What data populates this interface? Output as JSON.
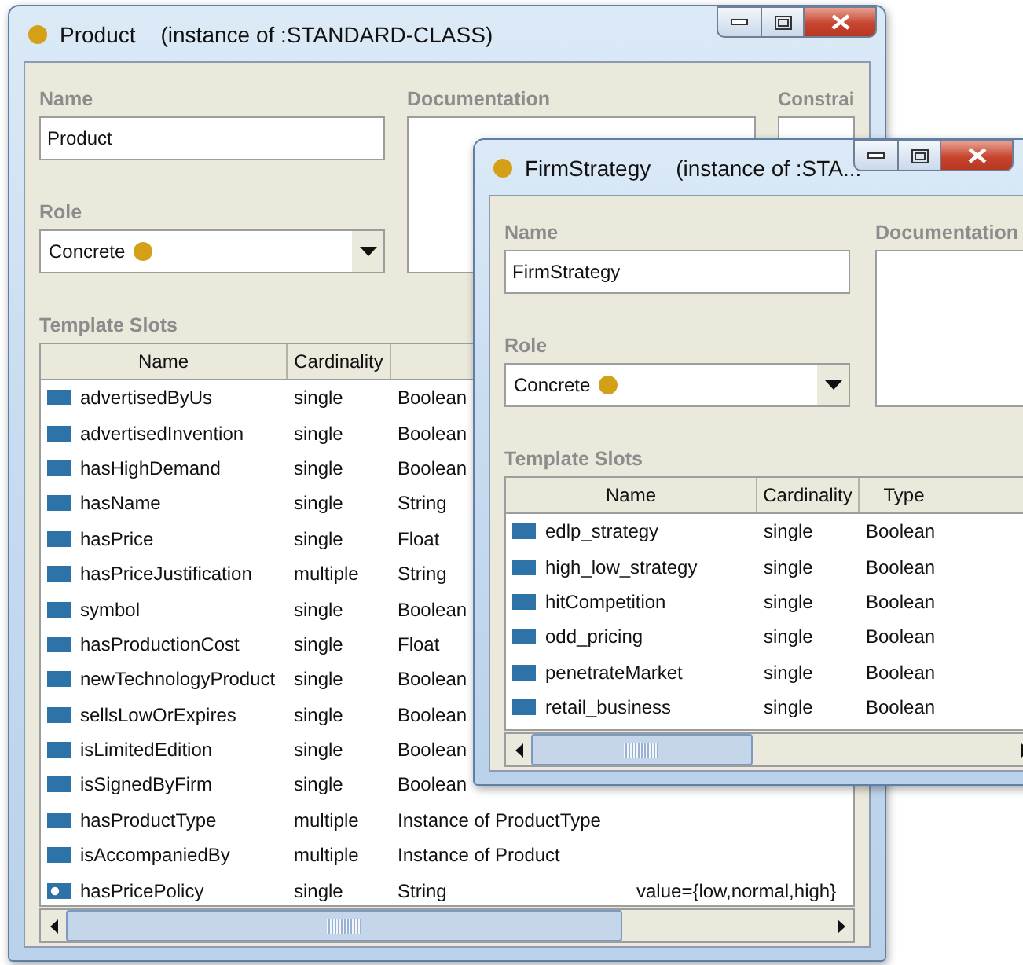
{
  "windows": [
    {
      "title": "Product",
      "subtitle": "(instance of :STANDARD-CLASS)",
      "name_label": "Name",
      "name_value": "Product",
      "documentation_label": "Documentation",
      "constraints_label": "Constrai",
      "role_label": "Role",
      "role_value": "Concrete",
      "slots_label": "Template Slots",
      "columns": [
        "Name",
        "Cardinality"
      ],
      "rows": [
        {
          "kind": "slot",
          "name": "advertisedByUs",
          "cardinality": "single",
          "type": "Boolean"
        },
        {
          "kind": "slot",
          "name": "advertisedInvention",
          "cardinality": "single",
          "type": "Boolean"
        },
        {
          "kind": "slot",
          "name": "hasHighDemand",
          "cardinality": "single",
          "type": "Boolean"
        },
        {
          "kind": "slot",
          "name": "hasName",
          "cardinality": "single",
          "type": "String"
        },
        {
          "kind": "slot",
          "name": "hasPrice",
          "cardinality": "single",
          "type": "Float"
        },
        {
          "kind": "slot",
          "name": "hasPriceJustification",
          "cardinality": "multiple",
          "type": "String"
        },
        {
          "kind": "slot",
          "name": "symbol",
          "cardinality": "single",
          "type": "Boolean"
        },
        {
          "kind": "slot",
          "name": "hasProductionCost",
          "cardinality": "single",
          "type": "Float"
        },
        {
          "kind": "slot",
          "name": "newTechnologyProduct",
          "cardinality": "single",
          "type": "Boolean"
        },
        {
          "kind": "slot",
          "name": "sellsLowOrExpires",
          "cardinality": "single",
          "type": "Boolean"
        },
        {
          "kind": "slot",
          "name": "isLimitedEdition",
          "cardinality": "single",
          "type": "Boolean"
        },
        {
          "kind": "slot",
          "name": "isSignedByFirm",
          "cardinality": "single",
          "type": "Boolean"
        },
        {
          "kind": "slot",
          "name": "hasProductType",
          "cardinality": "multiple",
          "type": "Instance of ProductType"
        },
        {
          "kind": "slot",
          "name": "isAccompaniedBy",
          "cardinality": "multiple",
          "type": "Instance of Product"
        },
        {
          "kind": "override",
          "name": "hasPricePolicy",
          "cardinality": "single",
          "type": "String",
          "column_4": "value={low,normal,high}"
        }
      ]
    },
    {
      "title": "FirmStrategy",
      "subtitle": "(instance of :STA...",
      "name_label": "Name",
      "name_value": "FirmStrategy",
      "documentation_label": "Documentation",
      "role_label": "Role",
      "role_value": "Concrete",
      "slots_label": "Template Slots",
      "columns": [
        "Name",
        "Cardinality",
        "Type"
      ],
      "rows": [
        {
          "kind": "slot",
          "name": "edlp_strategy",
          "cardinality": "single",
          "type": "Boolean"
        },
        {
          "kind": "slot",
          "name": "high_low_strategy",
          "cardinality": "single",
          "type": "Boolean"
        },
        {
          "kind": "slot",
          "name": "hitCompetition",
          "cardinality": "single",
          "type": "Boolean"
        },
        {
          "kind": "slot",
          "name": "odd_pricing",
          "cardinality": "single",
          "type": "Boolean"
        },
        {
          "kind": "slot",
          "name": "penetrateMarket",
          "cardinality": "single",
          "type": "Boolean"
        },
        {
          "kind": "slot",
          "name": "retail_business",
          "cardinality": "single",
          "type": "Boolean"
        }
      ]
    }
  ]
}
